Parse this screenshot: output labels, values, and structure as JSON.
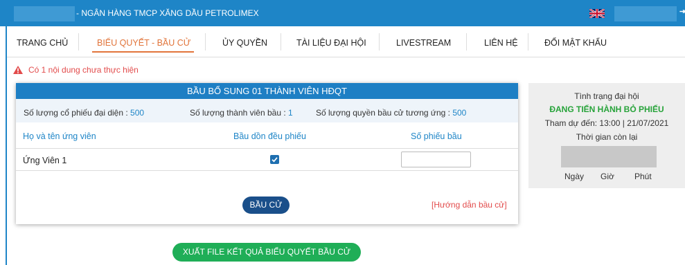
{
  "header": {
    "bank_name": "- NGÂN HÀNG TMCP XĂNG DẦU PETROLIMEX",
    "language_icon": "uk-flag-icon",
    "logout_icon": "logout-icon",
    "logout_glyph": "⇥"
  },
  "nav": {
    "items": [
      {
        "label": "TRANG CHỦ"
      },
      {
        "label": "BIỂU QUYẾT - BẦU CỬ",
        "active": true
      },
      {
        "label": "ỦY QUYỀN"
      },
      {
        "label": "TÀI LIỆU ĐẠI HỘI"
      },
      {
        "label": "LIVESTREAM"
      },
      {
        "label": "LIÊN HỆ"
      },
      {
        "label": "ĐỔI MẬT KHẨU"
      }
    ]
  },
  "warning": {
    "text": "Có 1 nội dung chưa thực hiện"
  },
  "ballot": {
    "title": "BẦU BỔ SUNG 01 THÀNH VIÊN HĐQT",
    "shares_label": "Số lượng cổ phiếu đại diện :",
    "shares_value": "500",
    "members_label": "Số lượng thành viên bầu :",
    "members_value": "1",
    "rights_label": "Số lượng quyền bầu cử tương ứng :",
    "rights_value": "500",
    "columns": [
      "Họ và tên ứng viên",
      "Bầu dồn đều phiếu",
      "Số phiếu bầu"
    ],
    "rows": [
      {
        "candidate": "Ứng Viên 1",
        "split_evenly": true,
        "votes": ""
      }
    ],
    "vote_button": "BẦU CỬ",
    "guide_link": "[Hướng dẫn bầu cử]"
  },
  "status": {
    "label": "Tình trạng đại hội",
    "state": "ĐANG TIẾN HÀNH BỎ PHIẾU",
    "attend": "Tham dự đến: 13:00 | 21/07/2021",
    "remaining_label": "Thời gian còn lại",
    "units": [
      "Ngày",
      "Giờ",
      "Phút"
    ]
  },
  "export_button": "XUẤT FILE KẾT QUẢ BIỂU QUYẾT BẦU CỬ",
  "colors": {
    "primary": "#1e85c7",
    "active_nav": "#e1743a",
    "warning": "#e24b4b",
    "success": "#27a33a",
    "export": "#1fae57",
    "vote_button": "#1a4f8a"
  }
}
